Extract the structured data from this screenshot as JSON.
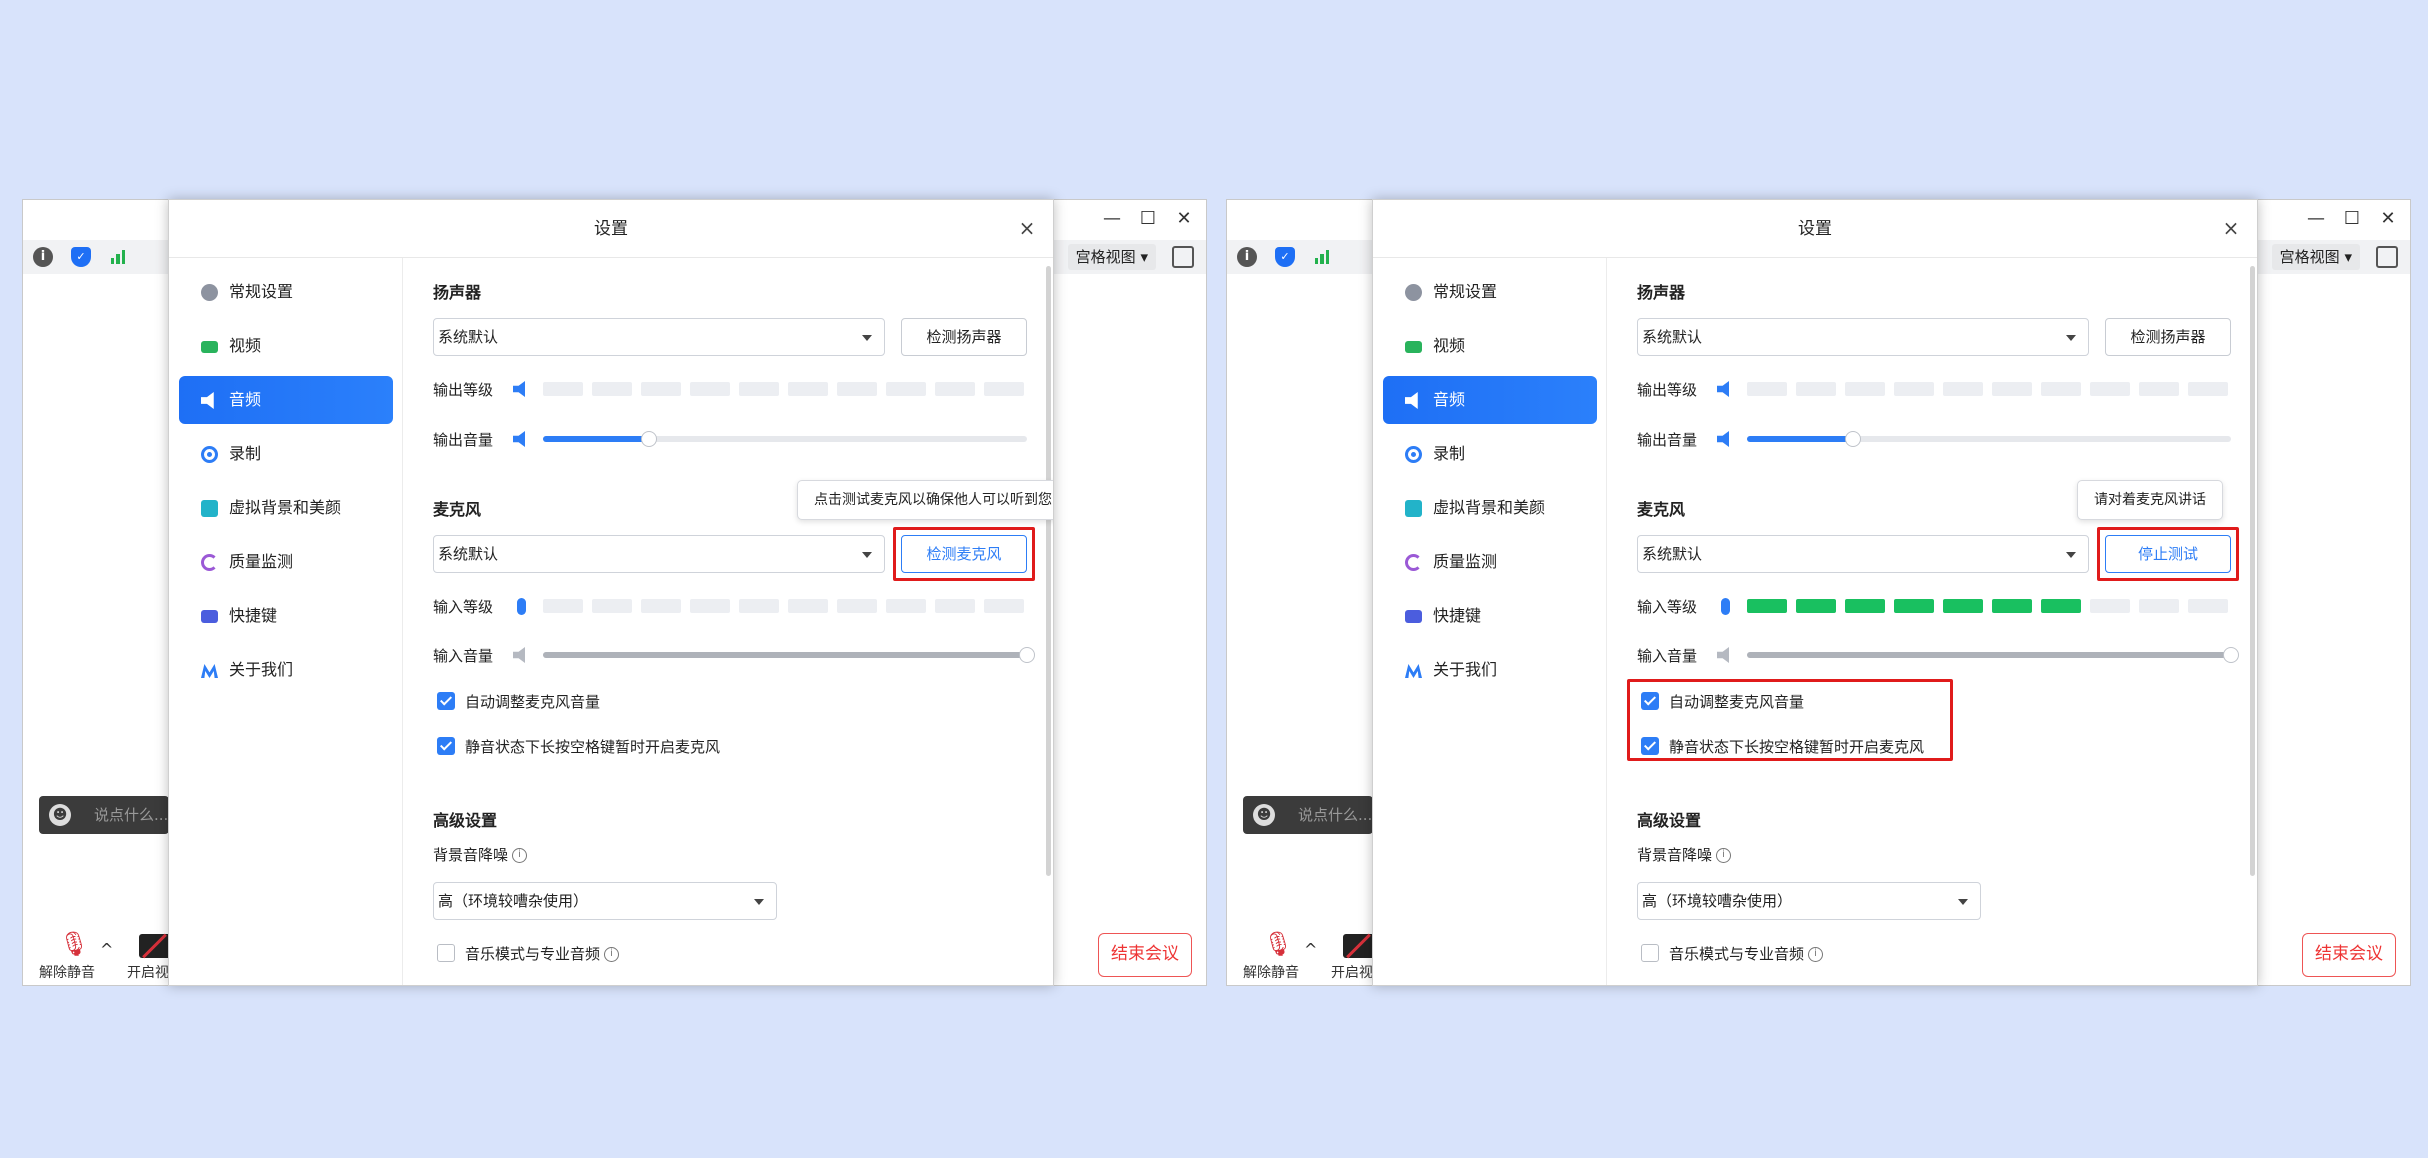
{
  "meeting": {
    "view_label": "宫格视图",
    "chat_placeholder": "说点什么...",
    "unmute_label": "解除静音",
    "video_label": "开启视",
    "end_label": "结束会议"
  },
  "settings": {
    "title": "设置",
    "close": "×",
    "nav": [
      "常规设置",
      "视频",
      "音频",
      "录制",
      "虚拟背景和美颜",
      "质量监测",
      "快捷键",
      "关于我们"
    ],
    "speaker": {
      "title": "扬声器",
      "device": "系统默认",
      "test_button": "检测扬声器",
      "output_level_label": "输出等级",
      "output_volume_label": "输出音量",
      "output_volume": 0.22
    },
    "mic": {
      "title": "麦克风",
      "device": "系统默认",
      "input_level_label": "输入等级",
      "input_volume_label": "输入音量",
      "input_volume": 1.0
    },
    "auto_adjust_label": "自动调整麦克风音量",
    "space_unmute_label": "静音状态下长按空格键暂时开启麦克风",
    "advanced": {
      "title": "高级设置",
      "noise_label": "背景音降噪",
      "noise_value": "高（环境较嘈杂使用）",
      "music_mode_label": "音乐模式与专业音频"
    }
  },
  "left": {
    "tooltip": "点击测试麦克风以确保他人可以听到您的声音",
    "mic_button": "检测麦克风",
    "input_level_segments_on": 0
  },
  "right": {
    "tooltip": "请对着麦克风讲话",
    "mic_button": "停止测试",
    "input_level_segments_on": 7
  },
  "colors": {
    "accent": "#2d7df6",
    "level_on": "#19c060",
    "highlight": "#e01b1b",
    "end_button": "#e33333"
  }
}
